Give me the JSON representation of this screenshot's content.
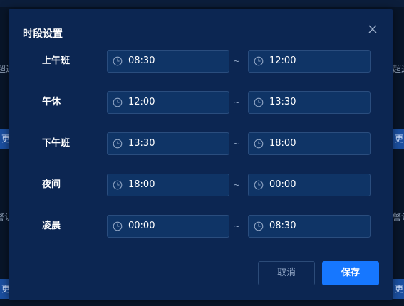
{
  "background": {
    "left_texts": [
      "超过",
      "更",
      "警认",
      "更"
    ],
    "right_texts": [
      "超过",
      "更",
      "警认",
      "更"
    ]
  },
  "modal": {
    "title": "时段设置",
    "separator": "~",
    "rows": [
      {
        "label": "上午班",
        "start": "08:30",
        "end": "12:00"
      },
      {
        "label": "午休",
        "start": "12:00",
        "end": "13:30"
      },
      {
        "label": "下午班",
        "start": "13:30",
        "end": "18:00"
      },
      {
        "label": "夜间",
        "start": "18:00",
        "end": "00:00"
      },
      {
        "label": "凌晨",
        "start": "00:00",
        "end": "08:30"
      }
    ],
    "cancel_label": "取消",
    "save_label": "保存"
  },
  "colors": {
    "modal_bg": "#0c2652",
    "field_bg": "#0f3466",
    "primary": "#1677ff"
  },
  "icons": {
    "clock": "clock-icon",
    "close": "close-icon"
  }
}
